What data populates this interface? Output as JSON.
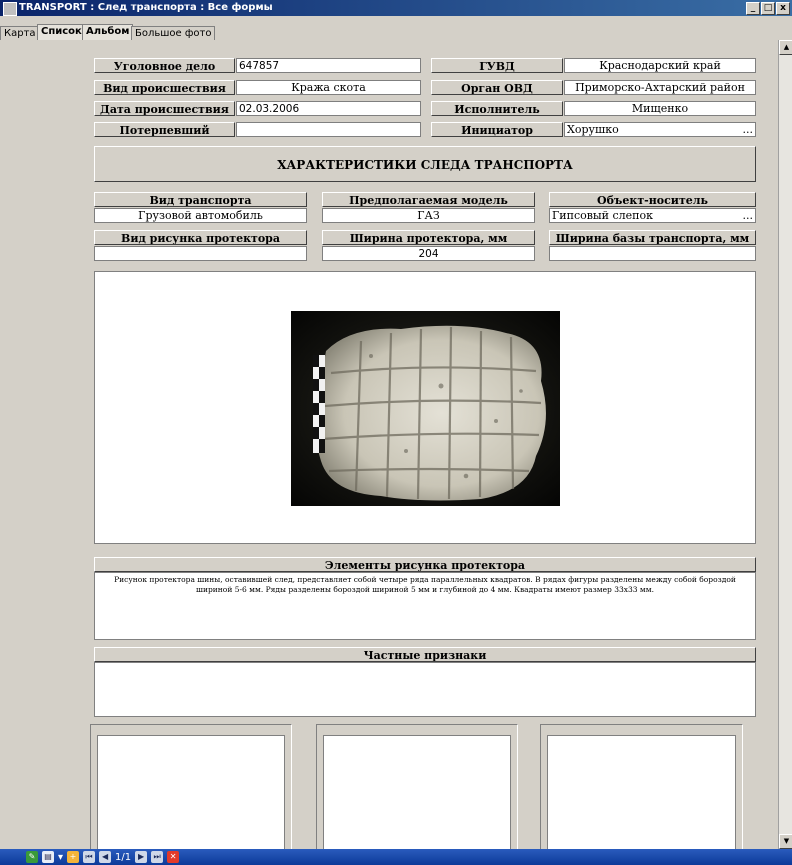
{
  "window": {
    "title": "TRANSPORT : След транспорта : Все формы",
    "buttons": [
      "_",
      "□",
      "x"
    ]
  },
  "tabs": [
    "Карта",
    "Список",
    "Альбом",
    "Большое фото"
  ],
  "fields": {
    "case": {
      "label": "Уголовное дело",
      "value": "647857"
    },
    "guvd": {
      "label": "ГУВД",
      "value": "Краснодарский край"
    },
    "incident_type": {
      "label": "Вид происшествия",
      "value": "Кража скота"
    },
    "ovd": {
      "label": "Орган ОВД",
      "value": "Приморско-Ахтарский район"
    },
    "date": {
      "label": "Дата происшествия",
      "value": "02.03.2006"
    },
    "executor": {
      "label": "Исполнитель",
      "value": "Мищенко"
    },
    "victim": {
      "label": "Потерпевший",
      "value": ""
    },
    "initiator": {
      "label": "Инициатор",
      "value": "Хорушко",
      "more": "..."
    }
  },
  "section_title": "ХАРАКТЕРИСТИКИ СЛЕДА ТРАНСПОРТА",
  "characteristics": {
    "vehicle_type": {
      "label": "Вид транспорта",
      "value": "Грузовой автомобиль"
    },
    "model": {
      "label": "Предполагаемая модель",
      "value": "ГАЗ"
    },
    "carrier": {
      "label": "Объект-носитель",
      "value": "Гипсовый слепок",
      "more": "..."
    },
    "tread_pattern": {
      "label": "Вид рисунка протектора",
      "value": ""
    },
    "tread_width": {
      "label": "Ширина протектора, мм",
      "value": "204"
    },
    "base_width": {
      "label": "Ширина базы транспорта, мм",
      "value": ""
    }
  },
  "tread_elements": {
    "label": "Элементы рисунка протектора",
    "text": "Рисунок протектора шины, оставившей след, представляет собой четыре ряда параллельных квадратов. В рядах фигуры разделены между собой бороздой шириной 5-6 мм. Ряды разделены бороздой шириной 5 мм и глубиной до 4 мм. Квадраты имеют размер 33х33 мм."
  },
  "private_features": {
    "label": "Частные признаки",
    "text": ""
  },
  "statusbar": {
    "record": "1/1"
  }
}
